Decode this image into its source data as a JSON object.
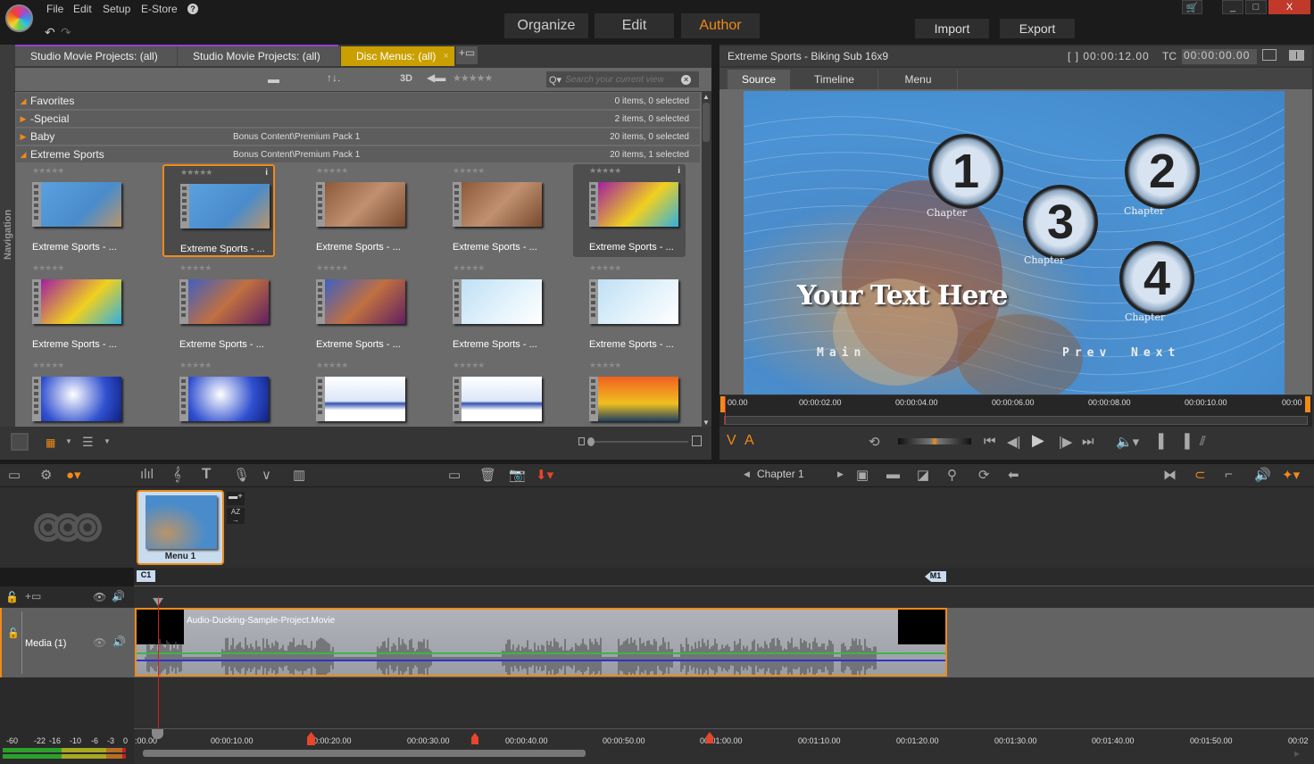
{
  "app": {
    "menu": [
      "File",
      "Edit",
      "Setup",
      "E-Store"
    ],
    "help_icon": "help-icon",
    "modes": [
      {
        "label": "Organize",
        "active": false
      },
      {
        "label": "Edit",
        "active": false
      },
      {
        "label": "Author",
        "active": true
      }
    ],
    "import_label": "Import",
    "export_label": "Export",
    "window_controls": {
      "minimize": "_",
      "maximize": "□",
      "close": "X"
    },
    "accent_color": "#f08a18"
  },
  "library": {
    "tabs": [
      {
        "label": "Studio Movie Projects: (all)",
        "active": false
      },
      {
        "label": "Studio Movie Projects: (all)",
        "active": false
      },
      {
        "label": "Disc Menus: (all)",
        "active": true
      }
    ],
    "toolbar": {
      "three_d": "3D",
      "search_placeholder": "Search your current view"
    },
    "navigation_label": "Navigation",
    "categories": [
      {
        "name": "Favorites",
        "path": "",
        "count": "0 items, 0 selected",
        "expanded": true
      },
      {
        "name": "-Special",
        "path": "",
        "count": "2 items, 0 selected",
        "expanded": false
      },
      {
        "name": "Baby",
        "path": "Bonus Content\\Premium Pack 1",
        "count": "20 items, 0 selected",
        "expanded": false
      },
      {
        "name": "Extreme Sports",
        "path": "Bonus Content\\Premium Pack 1",
        "count": "20 items, 1 selected",
        "expanded": true
      }
    ],
    "items": [
      {
        "label": "Extreme Sports - ...",
        "stars": "★★★★★",
        "theme": "bike"
      },
      {
        "label": "Extreme Sports - ...",
        "stars": "★★★★★",
        "theme": "bike-chapters",
        "selected": true
      },
      {
        "label": "Extreme Sports - ...",
        "stars": "★★★★★",
        "theme": "rock"
      },
      {
        "label": "Extreme Sports - ...",
        "stars": "★★★★★",
        "theme": "rock-chapters"
      },
      {
        "label": "Extreme Sports - ...",
        "stars": "★★★★★",
        "theme": "splash",
        "hover": true
      },
      {
        "label": "Extreme Sports - ...",
        "stars": "★★★★★",
        "theme": "splash-chapters"
      },
      {
        "label": "Extreme Sports - ...",
        "stars": "★★★★★",
        "theme": "skate"
      },
      {
        "label": "Extreme Sports - ...",
        "stars": "★★★★★",
        "theme": "skate-chapters"
      },
      {
        "label": "Extreme Sports - ...",
        "stars": "★★★★★",
        "theme": "snow"
      },
      {
        "label": "Extreme Sports - ...",
        "stars": "★★★★★",
        "theme": "snow-chapters"
      },
      {
        "label": "",
        "stars": "★★★★★",
        "theme": "blue"
      },
      {
        "label": "",
        "stars": "★★★★★",
        "theme": "blue-chapters"
      },
      {
        "label": "",
        "stars": "★★★★★",
        "theme": "wave"
      },
      {
        "label": "",
        "stars": "★★★★★",
        "theme": "wave-chapters"
      },
      {
        "label": "",
        "stars": "★★★★★",
        "theme": "sunset"
      }
    ]
  },
  "player": {
    "title": "Extreme Sports - Biking Sub 16x9",
    "duration": "[ ] 00:00:12.00",
    "tc_label": "TC",
    "timecode": "00:00:00.00",
    "tabs": [
      {
        "label": "Source",
        "active": true
      },
      {
        "label": "Timeline",
        "active": false
      },
      {
        "label": "Menu",
        "active": false
      }
    ],
    "menu_preview": {
      "headline": "Your Text Here",
      "buttons": [
        {
          "number": "1",
          "caption": "Chapter"
        },
        {
          "number": "2",
          "caption": "Chapter"
        },
        {
          "number": "3",
          "caption": "Chapter"
        },
        {
          "number": "4",
          "caption": "Chapter"
        }
      ],
      "nav": {
        "main": "Main",
        "prev": "Prev",
        "next": "Next"
      }
    },
    "ruler": [
      "00.00",
      "00:00:02.00",
      "00:00:04.00",
      "00:00:06.00",
      "00:00:08.00",
      "00:00:10.00",
      "00:00"
    ],
    "va": {
      "v": "V",
      "a": "A"
    }
  },
  "timeline_toolbar": {
    "chapter_label": "Chapter 1"
  },
  "disc": {
    "menu_label": "Menu 1",
    "chapter_marker": "C1",
    "return_marker": "M1",
    "sort_label": "AZ"
  },
  "tracks": [
    {
      "name": "Media (1)",
      "clip": "Audio-Ducking-Sample-Project.Movie"
    }
  ],
  "meter": {
    "labels": [
      "-60",
      "-22",
      "-16",
      "-10",
      "-6",
      "-3",
      "0"
    ]
  },
  "timeline_ruler": [
    ":00.00",
    "00:00:10.00",
    "00:00:20.00",
    "00:00:30.00",
    "00:00:40.00",
    "00:00:50.00",
    "00:01:00.00",
    "00:01:10.00",
    "00:01:20.00",
    "00:01:30.00",
    "00:01:40.00",
    "00:01:50.00",
    "00:02"
  ]
}
